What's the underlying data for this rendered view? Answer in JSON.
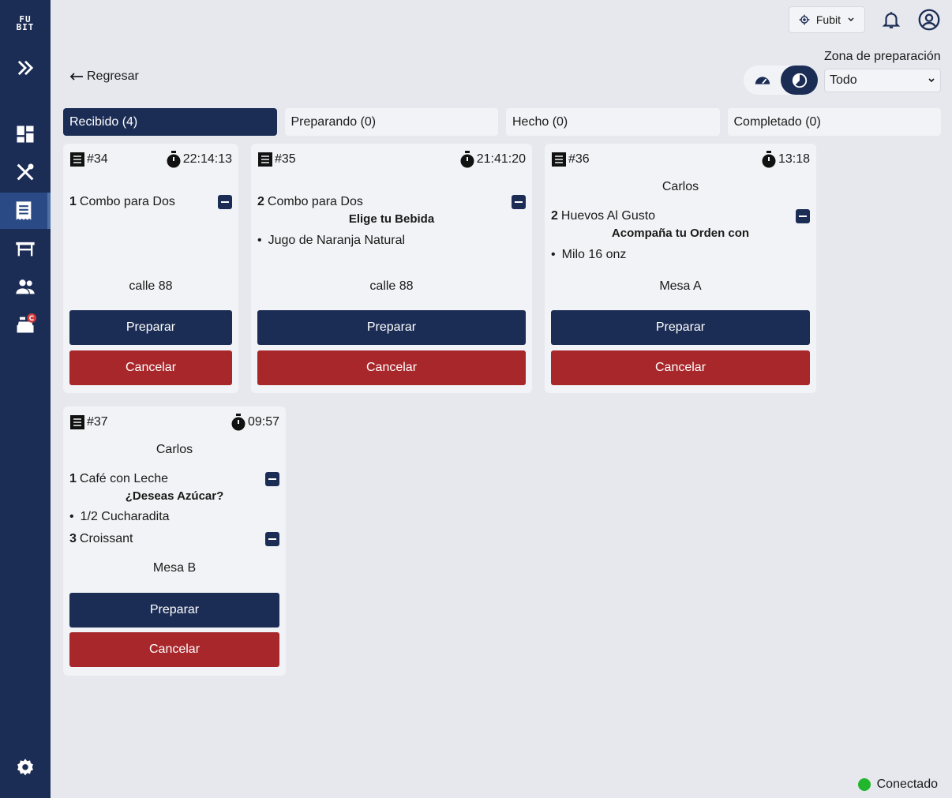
{
  "sidebar": {
    "logo_line1": "FU",
    "logo_line2": "BIT"
  },
  "header": {
    "business_name": "Fubit"
  },
  "nav": {
    "back_label": "Regresar"
  },
  "zone": {
    "label": "Zona de preparación",
    "value": "Todo"
  },
  "tabs": [
    {
      "label": "Recibido (4)"
    },
    {
      "label": "Preparando (0)"
    },
    {
      "label": "Hecho (0)"
    },
    {
      "label": "Completado (0)"
    }
  ],
  "orders": [
    {
      "number": "#34",
      "timer": "22:14:13",
      "customer": "",
      "items": [
        {
          "qty": "1",
          "name": "Combo para Dos"
        }
      ],
      "location": "calle 88"
    },
    {
      "number": "#35",
      "timer": "21:41:20",
      "customer": "",
      "items": [
        {
          "qty": "2",
          "name": "Combo para Dos",
          "group": "Elige tu Bebida",
          "option": "Jugo de Naranja Natural"
        }
      ],
      "location": "calle 88"
    },
    {
      "number": "#36",
      "timer": "13:18",
      "customer": "Carlos",
      "items": [
        {
          "qty": "2",
          "name": "Huevos Al Gusto",
          "group": "Acompaña tu Orden con",
          "option": "Milo 16 onz"
        }
      ],
      "location": "Mesa A"
    },
    {
      "number": "#37",
      "timer": "09:57",
      "customer": "Carlos",
      "items": [
        {
          "qty": "1",
          "name": "Café con Leche",
          "group": "¿Deseas Azúcar?",
          "option": "1/2 Cucharadita"
        },
        {
          "qty": "3",
          "name": "Croissant"
        }
      ],
      "location": "Mesa B"
    }
  ],
  "actions": {
    "prepare": "Preparar",
    "cancel": "Cancelar"
  },
  "connection": {
    "status": "Conectado",
    "color": "#22b62d"
  },
  "colors": {
    "navy": "#1c2d55",
    "red": "#a8272b",
    "background": "#e6e8ee",
    "card": "#f2f3f6"
  }
}
